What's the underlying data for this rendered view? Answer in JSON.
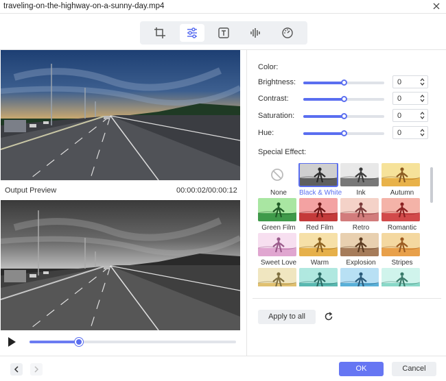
{
  "window": {
    "title": "traveling-on-the-highway-on-a-sunny-day.mp4"
  },
  "toolbar": {
    "tools": [
      {
        "name": "crop-icon",
        "active": false
      },
      {
        "name": "adjust-sliders-icon",
        "active": true
      },
      {
        "name": "text-icon",
        "active": false
      },
      {
        "name": "audio-icon",
        "active": false
      },
      {
        "name": "speed-icon",
        "active": false
      }
    ]
  },
  "preview": {
    "output_label": "Output Preview",
    "time": "00:00:02/00:00:12",
    "progress": 0.24
  },
  "color": {
    "title": "Color:",
    "rows": [
      {
        "label": "Brightness:",
        "value": "0",
        "level": 0.5
      },
      {
        "label": "Contrast:",
        "value": "0",
        "level": 0.5
      },
      {
        "label": "Saturation:",
        "value": "0",
        "level": 0.5
      },
      {
        "label": "Hue:",
        "value": "0",
        "level": 0.5
      }
    ]
  },
  "effects": {
    "title": "Special Effect:",
    "items": [
      {
        "label": "None",
        "style": "none"
      },
      {
        "label": "Black & White",
        "style": "bw",
        "selected": true
      },
      {
        "label": "Ink",
        "style": "ink"
      },
      {
        "label": "Autumn",
        "style": "autumn"
      },
      {
        "label": "Green Film",
        "style": "green"
      },
      {
        "label": "Red Film",
        "style": "red"
      },
      {
        "label": "Retro",
        "style": "retro"
      },
      {
        "label": "Romantic",
        "style": "romantic"
      },
      {
        "label": "Sweet Love",
        "style": "sweet"
      },
      {
        "label": "Warm",
        "style": "warm"
      },
      {
        "label": "Explosion",
        "style": "explosion"
      },
      {
        "label": "Stripes",
        "style": "stripes"
      },
      {
        "label": "",
        "style": "cool"
      },
      {
        "label": "",
        "style": "teal"
      },
      {
        "label": "",
        "style": "cyan"
      },
      {
        "label": "",
        "style": "mint"
      }
    ]
  },
  "actions": {
    "apply_all": "Apply to all",
    "ok": "OK",
    "cancel": "Cancel"
  }
}
